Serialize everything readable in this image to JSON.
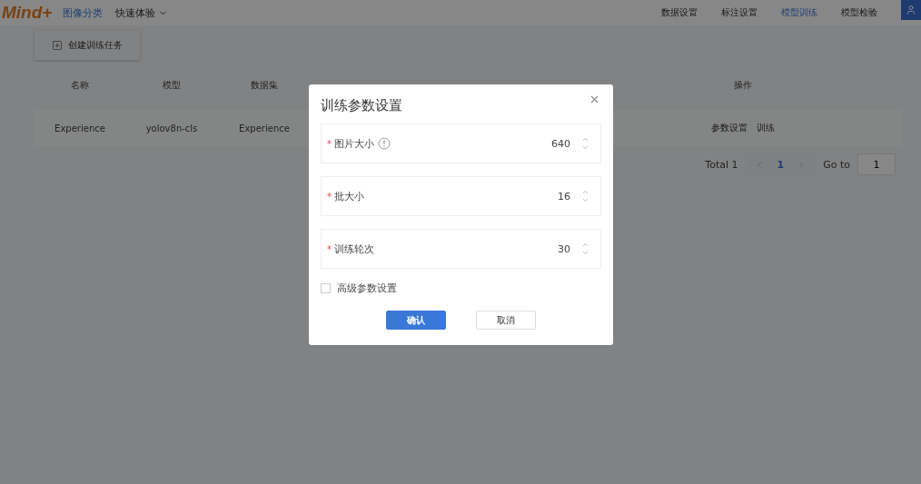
{
  "header": {
    "logo": "Mind+",
    "nav_left": [
      {
        "label": "图像分类",
        "selected": true
      },
      {
        "label": "快速体验",
        "selected": false
      }
    ],
    "nav_right": [
      {
        "label": "数据设置",
        "selected": false
      },
      {
        "label": "标注设置",
        "selected": false
      },
      {
        "label": "模型训练",
        "selected": true
      },
      {
        "label": "模型检验",
        "selected": false
      }
    ]
  },
  "toolbar": {
    "create_button": "创建训练任务"
  },
  "table": {
    "columns": [
      "名称",
      "模型",
      "数据集",
      "操作"
    ],
    "rows": [
      {
        "cells": [
          "Experience",
          "yolov8n-cls",
          "Experience"
        ],
        "actions": [
          "参数设置",
          "训练"
        ]
      }
    ]
  },
  "pagination": {
    "total": "Total 1",
    "pages": [
      {
        "label": "1",
        "selected": true
      }
    ],
    "goto_label": "Go to",
    "goto_value": "1"
  },
  "dialog": {
    "title": "训练参数设置",
    "fields": [
      {
        "required_mark": "*",
        "label": "图片大小",
        "info": true,
        "value": "640"
      },
      {
        "required_mark": "*",
        "label": "批大小",
        "info": false,
        "value": "16"
      },
      {
        "required_mark": "*",
        "label": "训练轮次",
        "info": false,
        "value": "30"
      }
    ],
    "advanced": {
      "label": "高级参数设置",
      "checked": false
    },
    "confirm": "确认",
    "cancel": "取消"
  }
}
